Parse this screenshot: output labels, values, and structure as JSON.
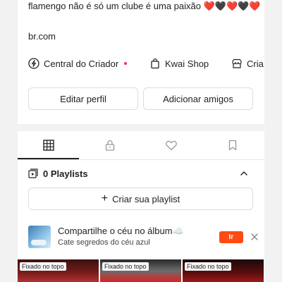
{
  "profile": {
    "bio": "flamengo não é só um clube é uma paixão ❤️🖤❤️🖤❤️",
    "link": "br.com"
  },
  "shortcuts": [
    {
      "label": "Central do Criador",
      "icon": "lightning-icon",
      "has_dot": true
    },
    {
      "label": "Kwai Shop",
      "icon": "shopping-bag-icon",
      "has_dot": false
    },
    {
      "label": "Cria",
      "icon": "store-icon",
      "has_dot": false
    }
  ],
  "actions": {
    "edit_label": "Editar perfil",
    "add_friends_label": "Adicionar amigos"
  },
  "tabs": [
    {
      "name": "grid",
      "icon": "grid-icon",
      "active": true
    },
    {
      "name": "private",
      "icon": "lock-icon",
      "active": false
    },
    {
      "name": "liked",
      "icon": "heart-icon",
      "active": false
    },
    {
      "name": "saved",
      "icon": "bookmark-icon",
      "active": false
    }
  ],
  "playlists": {
    "header": "0 Playlists",
    "create_label": "Criar sua playlist"
  },
  "banner": {
    "title": "Compartilhe o céu no álbum☁️",
    "subtitle": "Cate segredos do céu azul",
    "button_label": "Ir"
  },
  "videos": [
    {
      "badge": "Fixado no topo"
    },
    {
      "badge": "Fixado no topo"
    },
    {
      "badge": "Fixado no topo"
    }
  ],
  "colors": {
    "accent": "#fe4a15",
    "notification_dot": "#fe2c55",
    "background": "#f2f2f2"
  }
}
